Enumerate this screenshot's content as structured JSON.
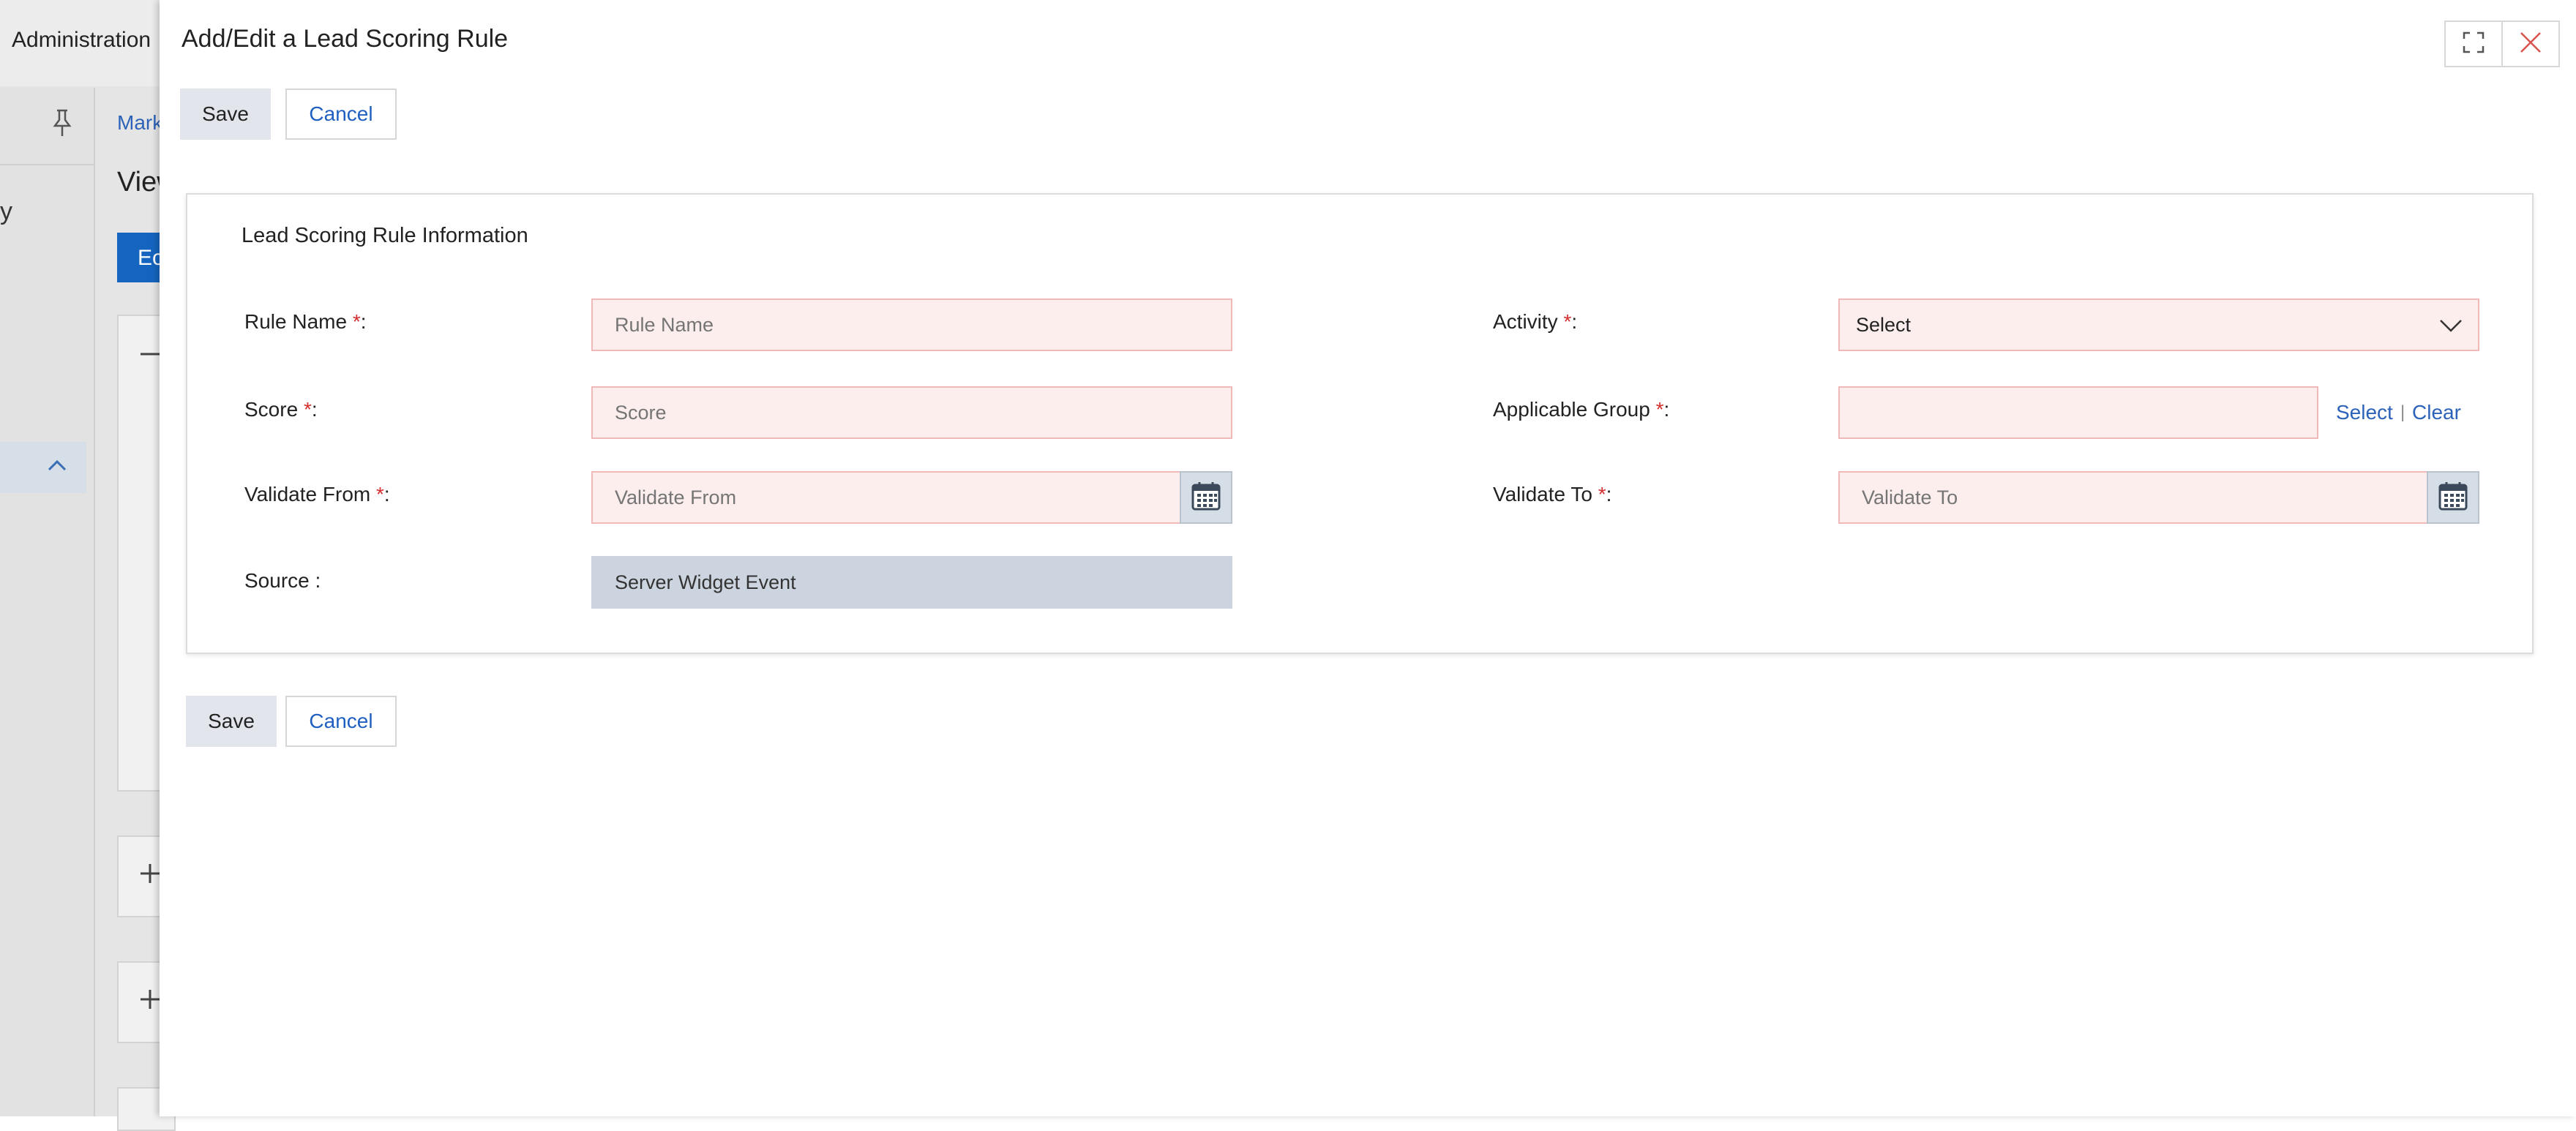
{
  "background": {
    "admin_label": "Administration",
    "link_fragment": "Mark",
    "view_fragment": "View",
    "edit_fragment": "Ec",
    "left_glyph": "y"
  },
  "dialog": {
    "title": "Add/Edit a Lead Scoring Rule",
    "save_label": "Save",
    "cancel_label": "Cancel"
  },
  "panel": {
    "title": "Lead Scoring Rule Information",
    "fields": {
      "rule_name": {
        "label": "Rule Name ",
        "required": "*",
        "colon": ":",
        "placeholder": "Rule Name"
      },
      "score": {
        "label": "Score  ",
        "required": "*",
        "colon": ":",
        "placeholder": "Score"
      },
      "validate_from": {
        "label": "Validate From  ",
        "required": "*",
        "colon": ":",
        "placeholder": "Validate From"
      },
      "source": {
        "label": "Source :",
        "value": "Server Widget Event"
      },
      "activity": {
        "label": "Activity ",
        "required": "*",
        "colon": ":",
        "value": "Select"
      },
      "applicable_group": {
        "label": "Applicable Group ",
        "required": "*",
        "colon": ":",
        "value": "",
        "select_link": "Select",
        "separator": "|",
        "clear_link": "Clear"
      },
      "validate_to": {
        "label": "Validate To  ",
        "required": "*",
        "colon": ":",
        "placeholder": "Validate To"
      }
    }
  },
  "icons": {
    "pin": "pin-icon",
    "chevron_up": "chevron-up-icon",
    "expand": "expand-icon",
    "close": "close-icon",
    "calendar": "calendar-icon",
    "chevron_down": "chevron-down-icon"
  },
  "colors": {
    "required": "#d32f2f",
    "link": "#2c63b8",
    "field_bg": "#fdeeee",
    "field_border": "#f0b9b9",
    "readonly_bg": "#ccd5df"
  }
}
